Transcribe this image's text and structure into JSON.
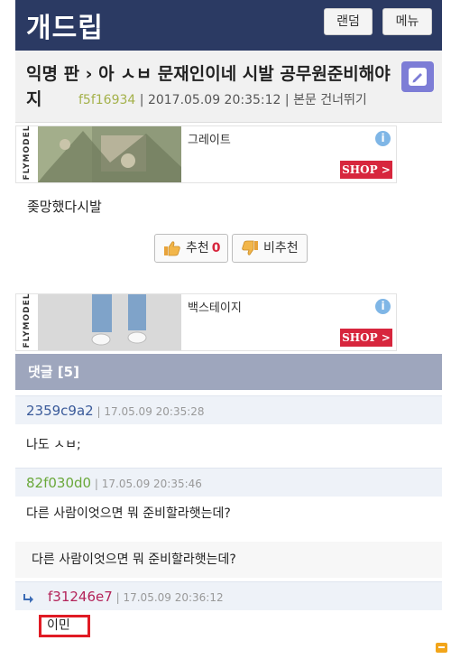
{
  "header": {
    "logo": "개드립",
    "random_label": "랜덤",
    "menu_label": "메뉴"
  },
  "post": {
    "title": "익명 판 › 아 ㅅㅂ 문재인이네 시발 공무원준비해야지",
    "author_id": "f5f16934",
    "datetime": "2017.05.09 20:35:12",
    "skip_link": "본문 건너뛰기",
    "separator": "|",
    "body": "좆망했다시발",
    "upvote_label": "추천",
    "upvote_count": "0",
    "downvote_label": "비추천"
  },
  "ads": [
    {
      "brand": "FLYMODEL",
      "name": "그레이트",
      "shop_label": "SHOP >"
    },
    {
      "brand": "FLYMODEL",
      "name": "백스테이지",
      "shop_label": "SHOP >"
    }
  ],
  "comments_section": {
    "header": "댓글 [5]"
  },
  "comments": [
    {
      "id": "2359c9a2",
      "time": "17.05.09 20:35:28",
      "text": "나도 ㅅㅂ;",
      "id_color": "#3b5b9a"
    },
    {
      "id": "82f030d0",
      "time": "17.05.09 20:35:46",
      "text": "다른 사람이엇으면 뭐 준비할라햇는데?",
      "id_color": "#6aa83a"
    }
  ],
  "reply": {
    "quoted_text": "다른 사람이엇으면 뭐 준비할라햇는데?",
    "id": "f31246e7",
    "time": "17.05.09 20:36:12",
    "text": "이민",
    "id_color": "#b4245a"
  },
  "colors": {
    "header_bg": "#2b3a63",
    "comment_header_bg": "#9ea6bd",
    "highlight_border": "#e01b24",
    "shop_bg": "#d7263d"
  }
}
